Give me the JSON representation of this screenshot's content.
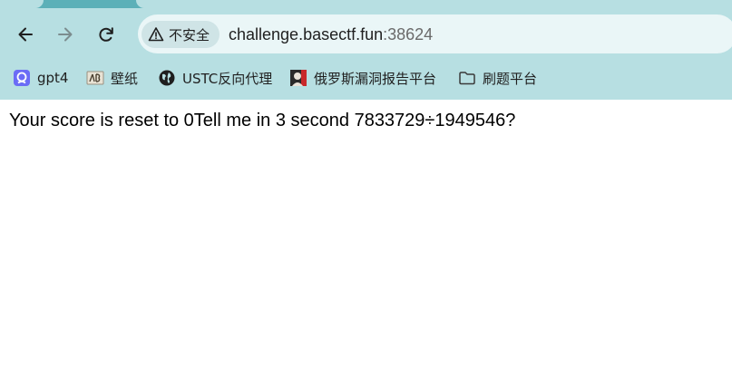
{
  "browser": {
    "security_label": "不安全",
    "url_host": "challenge.basectf.fun",
    "url_port": ":38624",
    "bookmarks": [
      {
        "label": "gpt4",
        "icon": "gpt-bookmark-icon"
      },
      {
        "label": "壁纸",
        "icon": "wallpaper-bookmark-icon"
      },
      {
        "label": "USTC反向代理",
        "icon": "globe-icon"
      },
      {
        "label": "俄罗斯漏洞报告平台",
        "icon": "avatar-bookmark-icon"
      },
      {
        "label": "刷题平台",
        "icon": "folder-icon"
      }
    ],
    "colors": {
      "toolbar": "#b7dfe2",
      "tabstrip": "#5cb0b8",
      "omnibox": "#eaf6f7"
    }
  },
  "page": {
    "message": "Your score is reset to 0Tell me in 3 second 7833729÷1949546?"
  }
}
